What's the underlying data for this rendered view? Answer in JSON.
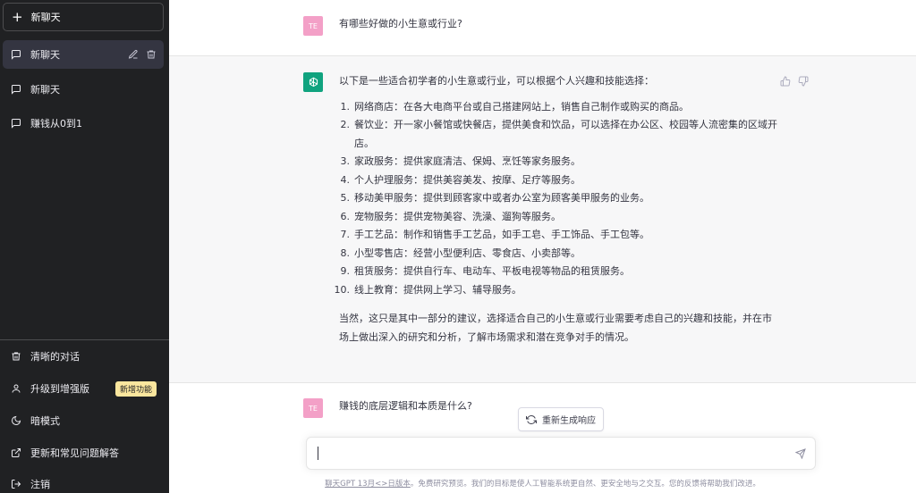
{
  "sidebar": {
    "new_chat_label": "新聊天",
    "conversations": [
      {
        "label": "新聊天",
        "active": true
      },
      {
        "label": "新聊天",
        "active": false
      },
      {
        "label": "赚钱从0到1",
        "active": false
      }
    ],
    "bottom": {
      "clear": "清晰的对话",
      "upgrade": "升级到增强版",
      "upgrade_badge": "新增功能",
      "dark_mode": "暗模式",
      "updates_faq": "更新和常见问题解答",
      "logout": "注销"
    }
  },
  "chat": {
    "user_avatar": "TE",
    "user_q1": "有哪些好做的小生意或行业?",
    "bot_intro": "以下是一些适合初学者的小生意或行业，可以根据个人兴趣和技能选择：",
    "bot_list": [
      {
        "num": "1.",
        "text": "网络商店：在各大电商平台或自己搭建网站上，销售自己制作或购买的商品。"
      },
      {
        "num": "2.",
        "text": "餐饮业：开一家小餐馆或快餐店，提供美食和饮品，可以选择在办公区、校园等人流密集的区域开店。"
      },
      {
        "num": "3.",
        "text": "家政服务：提供家庭清洁、保姆、烹饪等家务服务。"
      },
      {
        "num": "4.",
        "text": "个人护理服务：提供美容美发、按摩、足疗等服务。"
      },
      {
        "num": "5.",
        "text": "移动美甲服务：提供到顾客家中或者办公室为顾客美甲服务的业务。"
      },
      {
        "num": "6.",
        "text": "宠物服务：提供宠物美容、洗澡、遛狗等服务。"
      },
      {
        "num": "7.",
        "text": "手工艺品：制作和销售手工艺品，如手工皂、手工饰品、手工包等。"
      },
      {
        "num": "8.",
        "text": "小型零售店：经营小型便利店、零食店、小卖部等。"
      },
      {
        "num": "9.",
        "text": "租赁服务：提供自行车、电动车、平板电视等物品的租赁服务。"
      },
      {
        "num": "10.",
        "text": "线上教育：提供网上学习、辅导服务。"
      }
    ],
    "bot_outro": "当然，这只是其中一部分的建议，选择适合自己的小生意或行业需要考虑自己的兴趣和技能，并在市场上做出深入的研究和分析，了解市场需求和潜在竞争对手的情况。",
    "user_q2": "赚钱的底层逻辑和本质是什么?",
    "regenerate_label": "重新生成响应"
  },
  "input": {
    "value": "",
    "placeholder": ""
  },
  "footer": {
    "link_text": "聊天GPT 13月<>日版本",
    "rest": "。免费研究预览。我们的目标是使人工智能系统更自然、更安全地与之交互。您的反馈将帮助我们改进。"
  },
  "colors": {
    "sidebar_bg": "#202123",
    "active_item_bg": "#343541",
    "bot_avatar": "#10a37f",
    "user_avatar": "#f3a0c7",
    "badge_bg": "#fae69e"
  }
}
